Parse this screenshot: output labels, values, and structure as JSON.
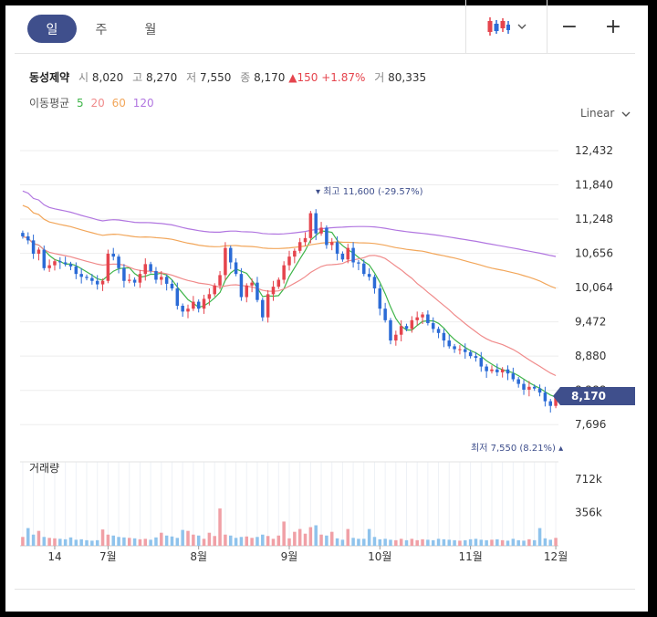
{
  "tabs": [
    {
      "label": "일",
      "active": true
    },
    {
      "label": "주",
      "active": false
    },
    {
      "label": "월",
      "active": false
    }
  ],
  "tools": {
    "zoom_out": "−",
    "zoom_in": "+",
    "chart_type_icon": "candlestick-icon",
    "dropdown_icon": "chevron-down-icon"
  },
  "quote": {
    "name": "동성제약",
    "open_label": "시",
    "open": "8,020",
    "high_label": "고",
    "high": "8,270",
    "low_label": "저",
    "low": "7,550",
    "close_label": "종",
    "close": "8,170",
    "change": "150",
    "change_pct": "+1.87%",
    "volume_label": "거",
    "volume": "80,335"
  },
  "ma": {
    "label": "이동평균",
    "periods": [
      "5",
      "20",
      "60",
      "120"
    ]
  },
  "scale_mode": "Linear",
  "colors": {
    "up": "#e5444d",
    "down": "#2b6bd6",
    "ma5": "#3fb54a",
    "ma20": "#f08b8b",
    "ma60": "#f2a65a",
    "ma120": "#b176e0",
    "accent": "#3f4f8c"
  },
  "chart_data": {
    "type": "candlestick",
    "title": "",
    "y_ticks": [
      "12,432",
      "11,840",
      "11,248",
      "10,656",
      "10,064",
      "9,472",
      "8,880",
      "8,288",
      "7,696"
    ],
    "ylim": [
      7400,
      12700
    ],
    "x_ticks": [
      "14",
      "7월",
      "8월",
      "9월",
      "10월",
      "11월",
      "12월"
    ],
    "current_price": "8,170",
    "high_annotation": "최고 11,600 (-29.57%)",
    "low_annotation": "최저 7,550 (8.21%)",
    "volume_title": "거래량",
    "volume_ticks": [
      "712k",
      "356k"
    ],
    "volume_max": 900,
    "closes": [
      10950,
      10880,
      10650,
      10720,
      10400,
      10450,
      10520,
      10500,
      10470,
      10430,
      10300,
      10250,
      10230,
      10180,
      10120,
      10180,
      10650,
      10600,
      10400,
      10180,
      10200,
      10150,
      10300,
      10470,
      10350,
      10200,
      10250,
      10130,
      10050,
      9750,
      9650,
      9700,
      9820,
      9700,
      9870,
      9950,
      10100,
      10280,
      10750,
      10500,
      10300,
      9900,
      10100,
      10150,
      9850,
      9550,
      9950,
      10080,
      10200,
      10450,
      10600,
      10700,
      10850,
      10920,
      11350,
      11000,
      11100,
      10800,
      10850,
      10650,
      10550,
      10750,
      10500,
      10480,
      10300,
      10250,
      10050,
      9700,
      9500,
      9150,
      9250,
      9400,
      9350,
      9500,
      9550,
      9600,
      9450,
      9350,
      9280,
      9150,
      9050,
      9000,
      9000,
      8950,
      8880,
      8850,
      8700,
      8620,
      8650,
      8600,
      8650,
      8580,
      8480,
      8400,
      8300,
      8350,
      8320,
      8250,
      8100,
      8020,
      8170
    ],
    "volumes": [
      95,
      190,
      120,
      160,
      95,
      85,
      80,
      75,
      70,
      90,
      65,
      70,
      60,
      55,
      60,
      175,
      120,
      110,
      95,
      90,
      85,
      80,
      70,
      75,
      65,
      90,
      140,
      110,
      100,
      85,
      170,
      160,
      120,
      110,
      75,
      140,
      105,
      400,
      120,
      110,
      85,
      95,
      100,
      85,
      95,
      120,
      105,
      75,
      110,
      260,
      80,
      150,
      180,
      130,
      200,
      220,
      120,
      110,
      150,
      80,
      65,
      180,
      85,
      75,
      75,
      180,
      95,
      70,
      75,
      65,
      60,
      75,
      60,
      75,
      60,
      70,
      65,
      60,
      75,
      70,
      65,
      60,
      55,
      60,
      70,
      75,
      65,
      60,
      65,
      70,
      60,
      55,
      75,
      60,
      55,
      70,
      60,
      190,
      80,
      65,
      85
    ]
  }
}
